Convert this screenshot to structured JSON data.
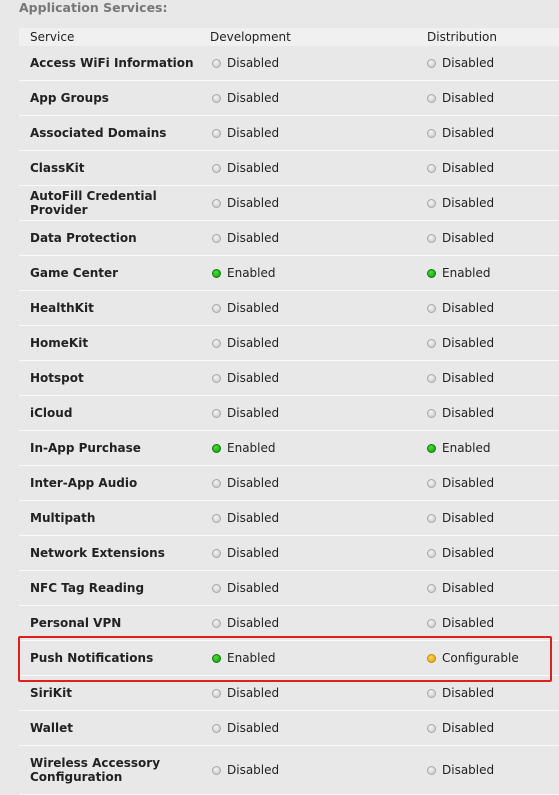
{
  "title": "Application Services:",
  "headers": {
    "service": "Service",
    "development": "Development",
    "distribution": "Distribution"
  },
  "status_colors": {
    "Disabled": "#c4c4c4",
    "Enabled": "#1aab12",
    "Configurable": "#f0aa10"
  },
  "rows": [
    {
      "service": "Access WiFi Information",
      "development": "Disabled",
      "distribution": "Disabled"
    },
    {
      "service": "App Groups",
      "development": "Disabled",
      "distribution": "Disabled"
    },
    {
      "service": "Associated Domains",
      "development": "Disabled",
      "distribution": "Disabled"
    },
    {
      "service": "ClassKit",
      "development": "Disabled",
      "distribution": "Disabled"
    },
    {
      "service": "AutoFill Credential Provider",
      "development": "Disabled",
      "distribution": "Disabled"
    },
    {
      "service": "Data Protection",
      "development": "Disabled",
      "distribution": "Disabled"
    },
    {
      "service": "Game Center",
      "development": "Enabled",
      "distribution": "Enabled"
    },
    {
      "service": "HealthKit",
      "development": "Disabled",
      "distribution": "Disabled"
    },
    {
      "service": "HomeKit",
      "development": "Disabled",
      "distribution": "Disabled"
    },
    {
      "service": "Hotspot",
      "development": "Disabled",
      "distribution": "Disabled"
    },
    {
      "service": "iCloud",
      "development": "Disabled",
      "distribution": "Disabled"
    },
    {
      "service": "In-App Purchase",
      "development": "Enabled",
      "distribution": "Enabled"
    },
    {
      "service": "Inter-App Audio",
      "development": "Disabled",
      "distribution": "Disabled"
    },
    {
      "service": "Multipath",
      "development": "Disabled",
      "distribution": "Disabled"
    },
    {
      "service": "Network Extensions",
      "development": "Disabled",
      "distribution": "Disabled"
    },
    {
      "service": "NFC Tag Reading",
      "development": "Disabled",
      "distribution": "Disabled"
    },
    {
      "service": "Personal VPN",
      "development": "Disabled",
      "distribution": "Disabled"
    },
    {
      "service": "Push Notifications",
      "development": "Enabled",
      "distribution": "Configurable",
      "highlighted": true
    },
    {
      "service": "SiriKit",
      "development": "Disabled",
      "distribution": "Disabled"
    },
    {
      "service": "Wallet",
      "development": "Disabled",
      "distribution": "Disabled"
    },
    {
      "service": "Wireless Accessory Configuration",
      "development": "Disabled",
      "distribution": "Disabled"
    }
  ]
}
